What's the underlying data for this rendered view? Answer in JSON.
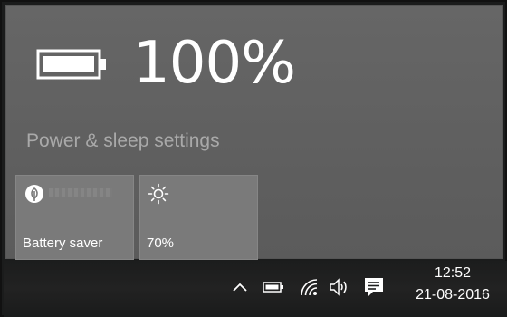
{
  "battery": {
    "percent_label": "100%",
    "level": 1.0,
    "icon": "battery-full-icon"
  },
  "settings": {
    "link_label": "Power & sleep settings"
  },
  "tiles": [
    {
      "label": "Battery saver",
      "icon": "battery-saver-leaf-icon"
    },
    {
      "label": "70%",
      "icon": "brightness-sun-icon"
    }
  ],
  "taskbar": {
    "tray_icons": [
      "chevron-up-icon",
      "battery-icon",
      "wifi-icon",
      "volume-icon",
      "action-center-icon"
    ],
    "clock": {
      "time": "12:52",
      "date": "21-08-2016"
    }
  },
  "colors": {
    "flyout_bg": "#666666",
    "tile_bg": "#7a7a7a",
    "taskbar_bg": "#1c1d1d",
    "link_text": "#a9a9a9"
  }
}
